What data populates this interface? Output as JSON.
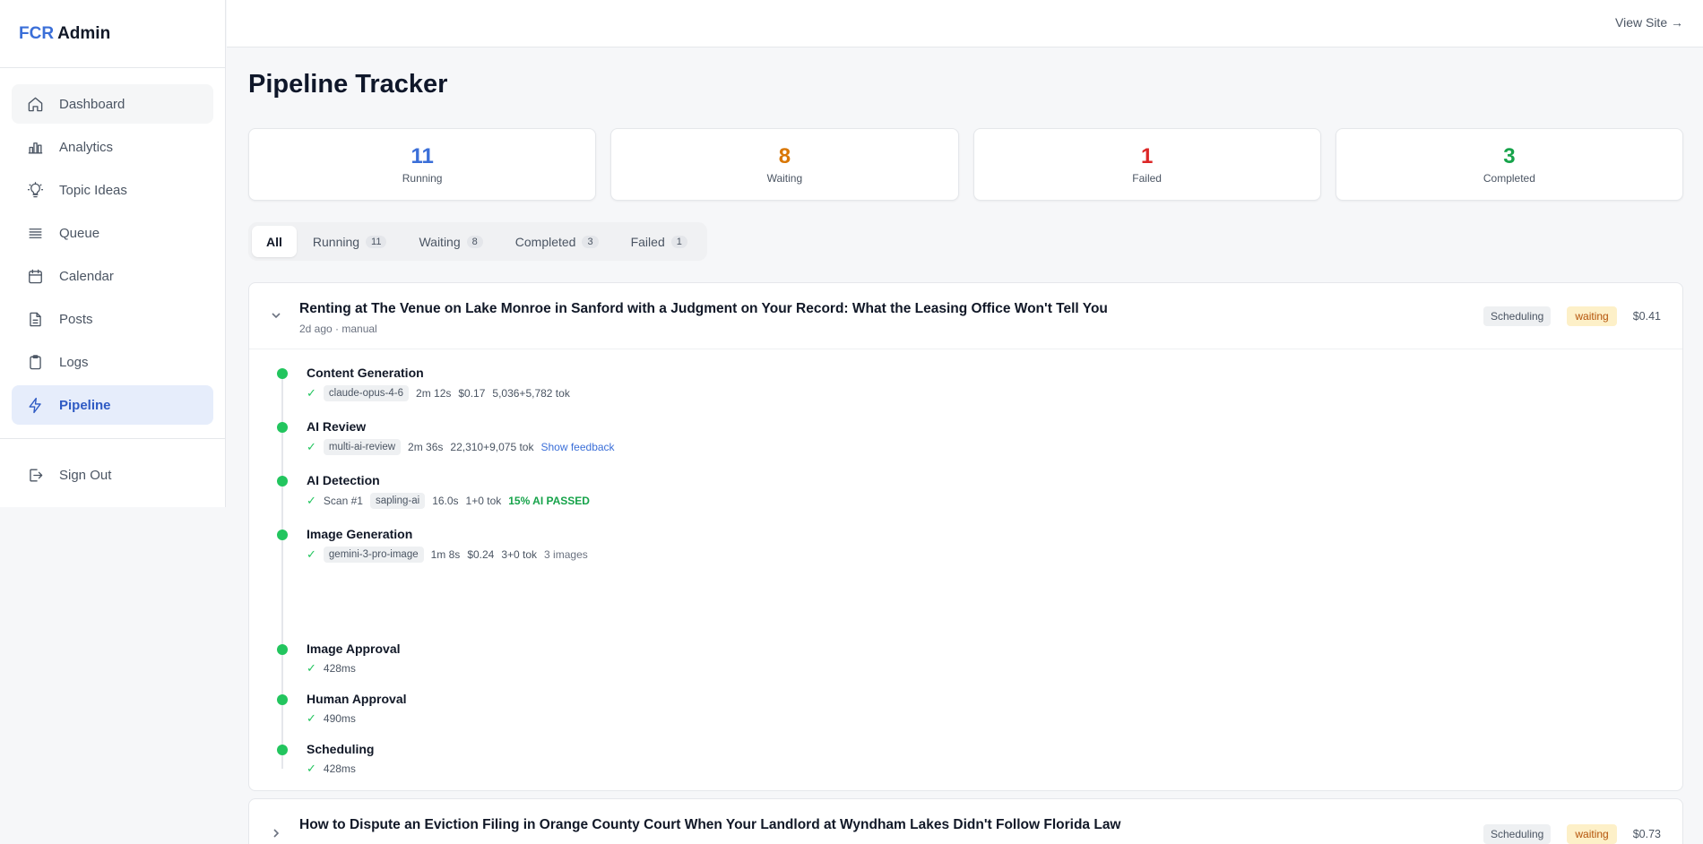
{
  "brand": {
    "accent": "FCR",
    "rest": "Admin"
  },
  "sidebar": {
    "items": [
      {
        "label": "Dashboard",
        "icon": "home-icon"
      },
      {
        "label": "Analytics",
        "icon": "bar-chart-icon"
      },
      {
        "label": "Topic Ideas",
        "icon": "lightbulb-icon"
      },
      {
        "label": "Queue",
        "icon": "list-icon"
      },
      {
        "label": "Calendar",
        "icon": "calendar-icon"
      },
      {
        "label": "Posts",
        "icon": "document-icon"
      },
      {
        "label": "Logs",
        "icon": "clipboard-icon"
      },
      {
        "label": "Pipeline",
        "icon": "lightning-icon",
        "active": true
      }
    ],
    "signout": "Sign Out"
  },
  "topbar": {
    "view_site": "View Site →"
  },
  "page": {
    "title": "Pipeline Tracker"
  },
  "stats": [
    {
      "value": "11",
      "label": "Running",
      "color": "#3b6fd8"
    },
    {
      "value": "8",
      "label": "Waiting",
      "color": "#d97706"
    },
    {
      "value": "1",
      "label": "Failed",
      "color": "#dc2626"
    },
    {
      "value": "3",
      "label": "Completed",
      "color": "#16a34a"
    }
  ],
  "filters": [
    {
      "label": "All",
      "count": ""
    },
    {
      "label": "Running",
      "count": "11"
    },
    {
      "label": "Waiting",
      "count": "8"
    },
    {
      "label": "Completed",
      "count": "3"
    },
    {
      "label": "Failed",
      "count": "1"
    }
  ],
  "cards": [
    {
      "title": "Renting at The Venue on Lake Monroe in Sanford with a Judgment on Your Record: What the Leasing Office Won't Tell You",
      "meta": "2d ago · manual",
      "stage": "Scheduling",
      "status": "waiting",
      "cost": "$0.41",
      "steps": [
        {
          "title": "Content Generation",
          "check": "✓",
          "chip": "claude-opus-4-6",
          "duration": "2m 12s",
          "cost": "$0.17",
          "tokens": "5,036+5,782 tok"
        },
        {
          "title": "AI Review",
          "check": "✓",
          "chip": "multi-ai-review",
          "duration": "2m 36s",
          "tokens": "22,310+9,075 tok",
          "link": "Show feedback"
        },
        {
          "title": "AI Detection",
          "check": "✓",
          "scan": "Scan #1",
          "chip": "sapling-ai",
          "duration": "16.0s",
          "tokens": "1+0 tok",
          "result": "15% AI PASSED"
        },
        {
          "title": "Image Generation",
          "check": "✓",
          "chip": "gemini-3-pro-image",
          "duration": "1m 8s",
          "cost": "$0.24",
          "tokens": "3+0 tok",
          "images": "3 images"
        },
        {
          "title": "Image Approval",
          "check": "✓",
          "duration": "428ms"
        },
        {
          "title": "Human Approval",
          "check": "✓",
          "duration": "490ms"
        },
        {
          "title": "Scheduling",
          "check": "✓",
          "duration": "428ms"
        }
      ]
    },
    {
      "title": "How to Dispute an Eviction Filing in Orange County Court When Your Landlord at Wyndham Lakes Didn't Follow Florida Law",
      "stage": "Scheduling",
      "status": "waiting",
      "cost": "$0.73"
    }
  ]
}
